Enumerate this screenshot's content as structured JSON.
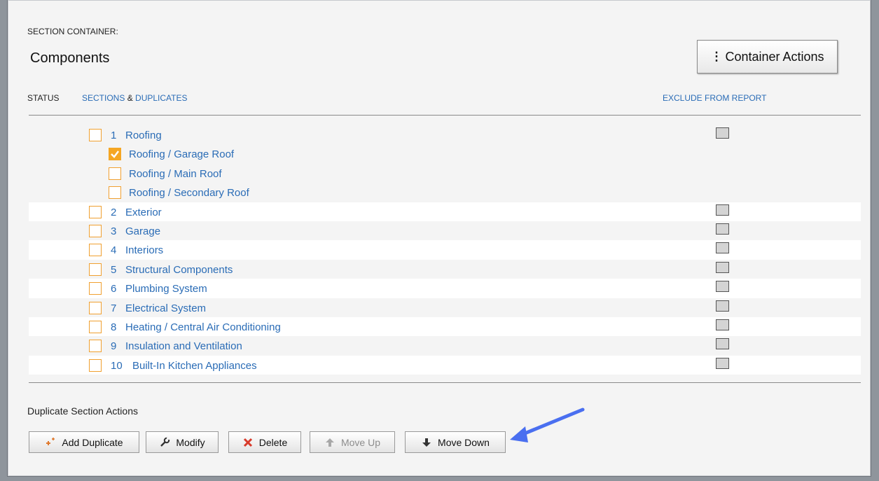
{
  "header": {
    "section_container_label": "SECTION CONTAINER:",
    "title": "Components",
    "container_actions_label": "Container Actions",
    "container_actions_icon": "kebab-icon"
  },
  "columns": {
    "status": "STATUS",
    "sections": "SECTIONS",
    "ampersand": "&",
    "duplicates": "DUPLICATES",
    "exclude": "EXCLUDE FROM REPORT"
  },
  "sections": [
    {
      "num": "1",
      "label": "Roofing",
      "checked": false,
      "exclude_box": true,
      "indent": false
    },
    {
      "num": "",
      "label": "Roofing / Garage Roof",
      "checked": true,
      "exclude_box": false,
      "indent": true
    },
    {
      "num": "",
      "label": "Roofing / Main Roof",
      "checked": false,
      "exclude_box": false,
      "indent": true
    },
    {
      "num": "",
      "label": "Roofing / Secondary Roof",
      "checked": false,
      "exclude_box": false,
      "indent": true
    },
    {
      "num": "2",
      "label": "Exterior",
      "checked": false,
      "exclude_box": true,
      "indent": false
    },
    {
      "num": "3",
      "label": "Garage",
      "checked": false,
      "exclude_box": true,
      "indent": false
    },
    {
      "num": "4",
      "label": "Interiors",
      "checked": false,
      "exclude_box": true,
      "indent": false
    },
    {
      "num": "5",
      "label": "Structural Components",
      "checked": false,
      "exclude_box": true,
      "indent": false
    },
    {
      "num": "6",
      "label": "Plumbing System",
      "checked": false,
      "exclude_box": true,
      "indent": false
    },
    {
      "num": "7",
      "label": "Electrical System",
      "checked": false,
      "exclude_box": true,
      "indent": false
    },
    {
      "num": "8",
      "label": "Heating / Central Air Conditioning",
      "checked": false,
      "exclude_box": true,
      "indent": false
    },
    {
      "num": "9",
      "label": "Insulation and Ventilation",
      "checked": false,
      "exclude_box": true,
      "indent": false
    },
    {
      "num": "10",
      "label": "Built-In Kitchen Appliances",
      "checked": false,
      "exclude_box": true,
      "indent": false
    }
  ],
  "duplicate_actions": {
    "label": "Duplicate Section Actions",
    "buttons": [
      {
        "label": "Add Duplicate",
        "icon": "add-duplicate-icon",
        "enabled": true
      },
      {
        "label": "Modify",
        "icon": "wrench-icon",
        "enabled": true
      },
      {
        "label": "Delete",
        "icon": "close-icon",
        "enabled": true
      },
      {
        "label": "Move Up",
        "icon": "arrow-up-icon",
        "enabled": false
      },
      {
        "label": "Move Down",
        "icon": "arrow-down-icon",
        "enabled": true
      }
    ]
  },
  "colors": {
    "link": "#2a6cb6",
    "checkbox_accent": "#f5a623",
    "annotation_arrow": "#4a6ff0"
  }
}
